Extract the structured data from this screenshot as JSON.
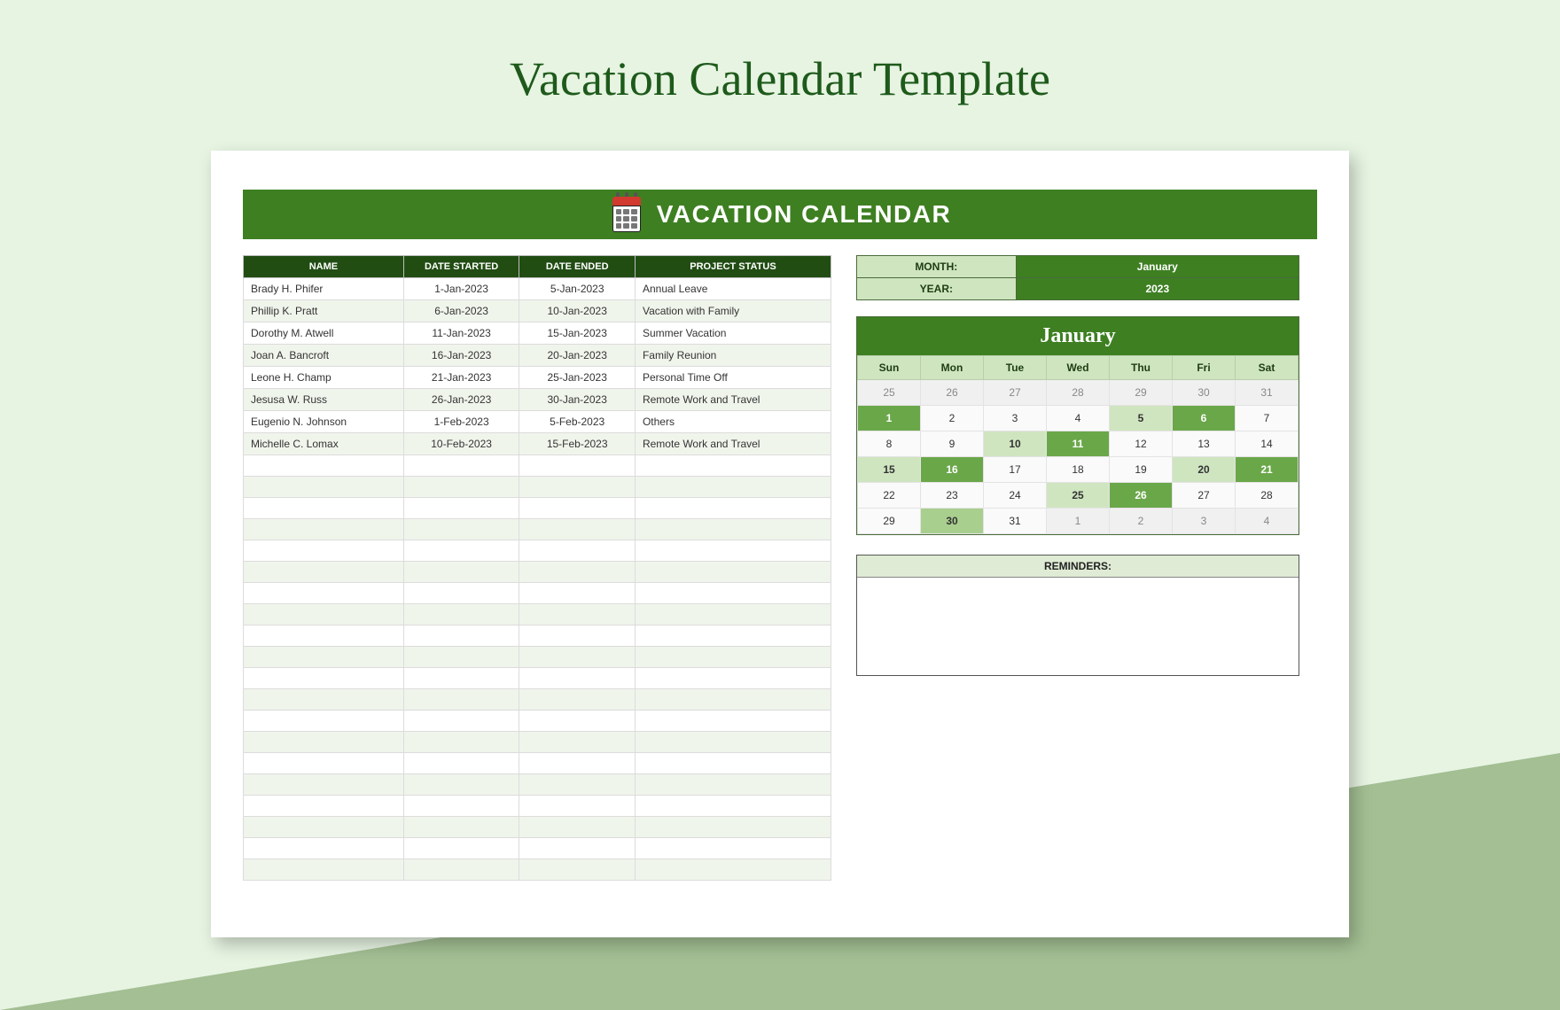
{
  "page": {
    "title": "Vacation Calendar Template"
  },
  "banner": {
    "title": "VACATION CALENDAR"
  },
  "table": {
    "headers": {
      "name": "NAME",
      "date_started": "DATE STARTED",
      "date_ended": "DATE ENDED",
      "status": "PROJECT STATUS"
    },
    "rows": [
      {
        "name": "Brady H. Phifer",
        "ds": "1-Jan-2023",
        "de": "5-Jan-2023",
        "status": "Annual Leave"
      },
      {
        "name": "Phillip K. Pratt",
        "ds": "6-Jan-2023",
        "de": "10-Jan-2023",
        "status": "Vacation with Family"
      },
      {
        "name": "Dorothy M. Atwell",
        "ds": "11-Jan-2023",
        "de": "15-Jan-2023",
        "status": "Summer Vacation"
      },
      {
        "name": "Joan A. Bancroft",
        "ds": "16-Jan-2023",
        "de": "20-Jan-2023",
        "status": "Family Reunion"
      },
      {
        "name": "Leone H. Champ",
        "ds": "21-Jan-2023",
        "de": "25-Jan-2023",
        "status": "Personal Time Off"
      },
      {
        "name": "Jesusa W. Russ",
        "ds": "26-Jan-2023",
        "de": "30-Jan-2023",
        "status": "Remote Work and Travel"
      },
      {
        "name": "Eugenio N. Johnson",
        "ds": "1-Feb-2023",
        "de": "5-Feb-2023",
        "status": "Others"
      },
      {
        "name": "Michelle C. Lomax",
        "ds": "10-Feb-2023",
        "de": "15-Feb-2023",
        "status": "Remote Work and Travel"
      }
    ],
    "empty_rows": 20
  },
  "meta": {
    "month_label": "MONTH:",
    "month_value": "January",
    "year_label": "YEAR:",
    "year_value": "2023"
  },
  "calendar": {
    "title": "January",
    "dow": [
      "Sun",
      "Mon",
      "Tue",
      "Wed",
      "Thu",
      "Fri",
      "Sat"
    ],
    "weeks": [
      [
        {
          "d": "25",
          "cls": "other-month"
        },
        {
          "d": "26",
          "cls": "other-month"
        },
        {
          "d": "27",
          "cls": "other-month"
        },
        {
          "d": "28",
          "cls": "other-month"
        },
        {
          "d": "29",
          "cls": "other-month"
        },
        {
          "d": "30",
          "cls": "other-month"
        },
        {
          "d": "31",
          "cls": "other-month"
        }
      ],
      [
        {
          "d": "1",
          "cls": "shade-dark"
        },
        {
          "d": "2",
          "cls": ""
        },
        {
          "d": "3",
          "cls": ""
        },
        {
          "d": "4",
          "cls": ""
        },
        {
          "d": "5",
          "cls": "shade-light"
        },
        {
          "d": "6",
          "cls": "shade-dark"
        },
        {
          "d": "7",
          "cls": ""
        }
      ],
      [
        {
          "d": "8",
          "cls": ""
        },
        {
          "d": "9",
          "cls": ""
        },
        {
          "d": "10",
          "cls": "shade-light"
        },
        {
          "d": "11",
          "cls": "shade-dark"
        },
        {
          "d": "12",
          "cls": ""
        },
        {
          "d": "13",
          "cls": ""
        },
        {
          "d": "14",
          "cls": ""
        }
      ],
      [
        {
          "d": "15",
          "cls": "shade-light"
        },
        {
          "d": "16",
          "cls": "shade-dark"
        },
        {
          "d": "17",
          "cls": ""
        },
        {
          "d": "18",
          "cls": ""
        },
        {
          "d": "19",
          "cls": ""
        },
        {
          "d": "20",
          "cls": "shade-light"
        },
        {
          "d": "21",
          "cls": "shade-dark"
        }
      ],
      [
        {
          "d": "22",
          "cls": ""
        },
        {
          "d": "23",
          "cls": ""
        },
        {
          "d": "24",
          "cls": ""
        },
        {
          "d": "25",
          "cls": "shade-light"
        },
        {
          "d": "26",
          "cls": "shade-dark"
        },
        {
          "d": "27",
          "cls": ""
        },
        {
          "d": "28",
          "cls": ""
        }
      ],
      [
        {
          "d": "29",
          "cls": ""
        },
        {
          "d": "30",
          "cls": "shade-mid"
        },
        {
          "d": "31",
          "cls": ""
        },
        {
          "d": "1",
          "cls": "other-month"
        },
        {
          "d": "2",
          "cls": "other-month"
        },
        {
          "d": "3",
          "cls": "other-month"
        },
        {
          "d": "4",
          "cls": "other-month"
        }
      ]
    ]
  },
  "reminders": {
    "label": "REMINDERS:"
  }
}
